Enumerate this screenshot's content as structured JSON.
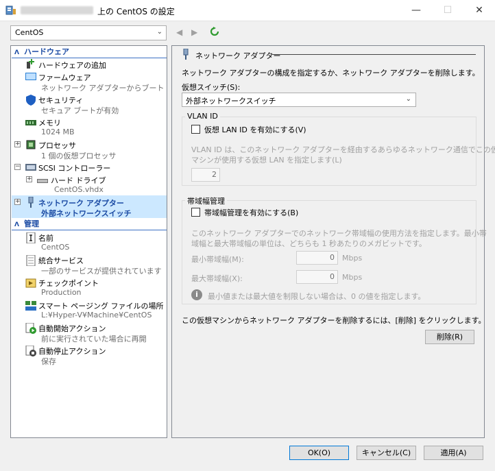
{
  "window": {
    "title": "上の CentOS の設定",
    "minimize": "—",
    "maximize": "☐",
    "close": "✕"
  },
  "toolbar": {
    "vm_name": "CentOS",
    "back": "◀",
    "forward": "▶"
  },
  "sidebar": {
    "hardware_header": "ハードウェア",
    "management_header": "管理",
    "hardware_items": [
      {
        "label": "ハードウェアの追加",
        "sub": "",
        "icon": "add-hardware-icon"
      },
      {
        "label": "ファームウェア",
        "sub": "ネットワーク アダプターからブート",
        "icon": "firmware-icon"
      },
      {
        "label": "セキュリティ",
        "sub": "セキュア ブートが有効",
        "icon": "shield-icon"
      },
      {
        "label": "メモリ",
        "sub": "1024 MB",
        "icon": "memory-icon"
      },
      {
        "label": "プロセッサ",
        "sub": "1 個の仮想プロセッサ",
        "icon": "processor-icon"
      },
      {
        "label": "SCSI コントローラー",
        "sub": "",
        "icon": "scsi-controller-icon"
      },
      {
        "label": "ハード ドライブ",
        "sub": "CentOS.vhdx",
        "icon": "hard-drive-icon"
      },
      {
        "label": "ネットワーク アダプター",
        "sub": "外部ネットワークスイッチ",
        "icon": "network-adapter-icon"
      }
    ],
    "management_items": [
      {
        "label": "名前",
        "sub": "CentOS",
        "icon": "name-icon"
      },
      {
        "label": "統合サービス",
        "sub": "一部のサービスが提供されています",
        "icon": "integration-services-icon"
      },
      {
        "label": "チェックポイント",
        "sub": "Production",
        "icon": "checkpoint-icon"
      },
      {
        "label": "スマート ページング ファイルの場所",
        "sub": "L:¥Hyper-V¥Machine¥CentOS",
        "icon": "smart-paging-icon"
      },
      {
        "label": "自動開始アクション",
        "sub": "前に実行されていた場合に再開",
        "icon": "auto-start-icon"
      },
      {
        "label": "自動停止アクション",
        "sub": "保存",
        "icon": "auto-stop-icon"
      }
    ]
  },
  "panel": {
    "title": "ネットワーク アダプター",
    "description": "ネットワーク アダプターの構成を指定するか、ネットワーク アダプターを削除します。",
    "switch_label": "仮想スイッチ(S):",
    "switch_value": "外部ネットワークスイッチ",
    "vlan": {
      "title": "VLAN ID",
      "enable_label": "仮想 LAN ID を有効にする(V)",
      "enabled": false,
      "desc_line1": "VLAN ID は、このネットワーク アダプターを経由するあらゆるネットワーク通信でこの仮想",
      "desc_line2": "マシンが使用する仮想 LAN を指定します(L)",
      "value": "2"
    },
    "bandwidth": {
      "title": "帯域幅管理",
      "enable_label": "帯域幅管理を有効にする(B)",
      "enabled": false,
      "desc_line1": "このネットワーク アダプターでのネットワーク帯域幅の使用方法を指定します。最小帯",
      "desc_line2": "域幅と最大帯域幅の単位は、どちらも 1 秒あたりのメガビットです。",
      "min_label": "最小帯域幅(M):",
      "min_value": "0",
      "max_label": "最大帯域幅(X):",
      "max_value": "0",
      "unit": "Mbps",
      "info": "最小値または最大値を制限しない場合は、0 の値を指定します。"
    },
    "remove_text": "この仮想マシンからネットワーク アダプターを削除するには、[削除] をクリックします。",
    "remove_button": "削除(R)"
  },
  "footer": {
    "ok": "OK(O)",
    "cancel": "キャンセル(C)",
    "apply": "適用(A)"
  },
  "colors": {
    "accent": "#1a4aa3",
    "selected_bg": "#cce8ff",
    "window_bg": "#f0f0f0"
  }
}
